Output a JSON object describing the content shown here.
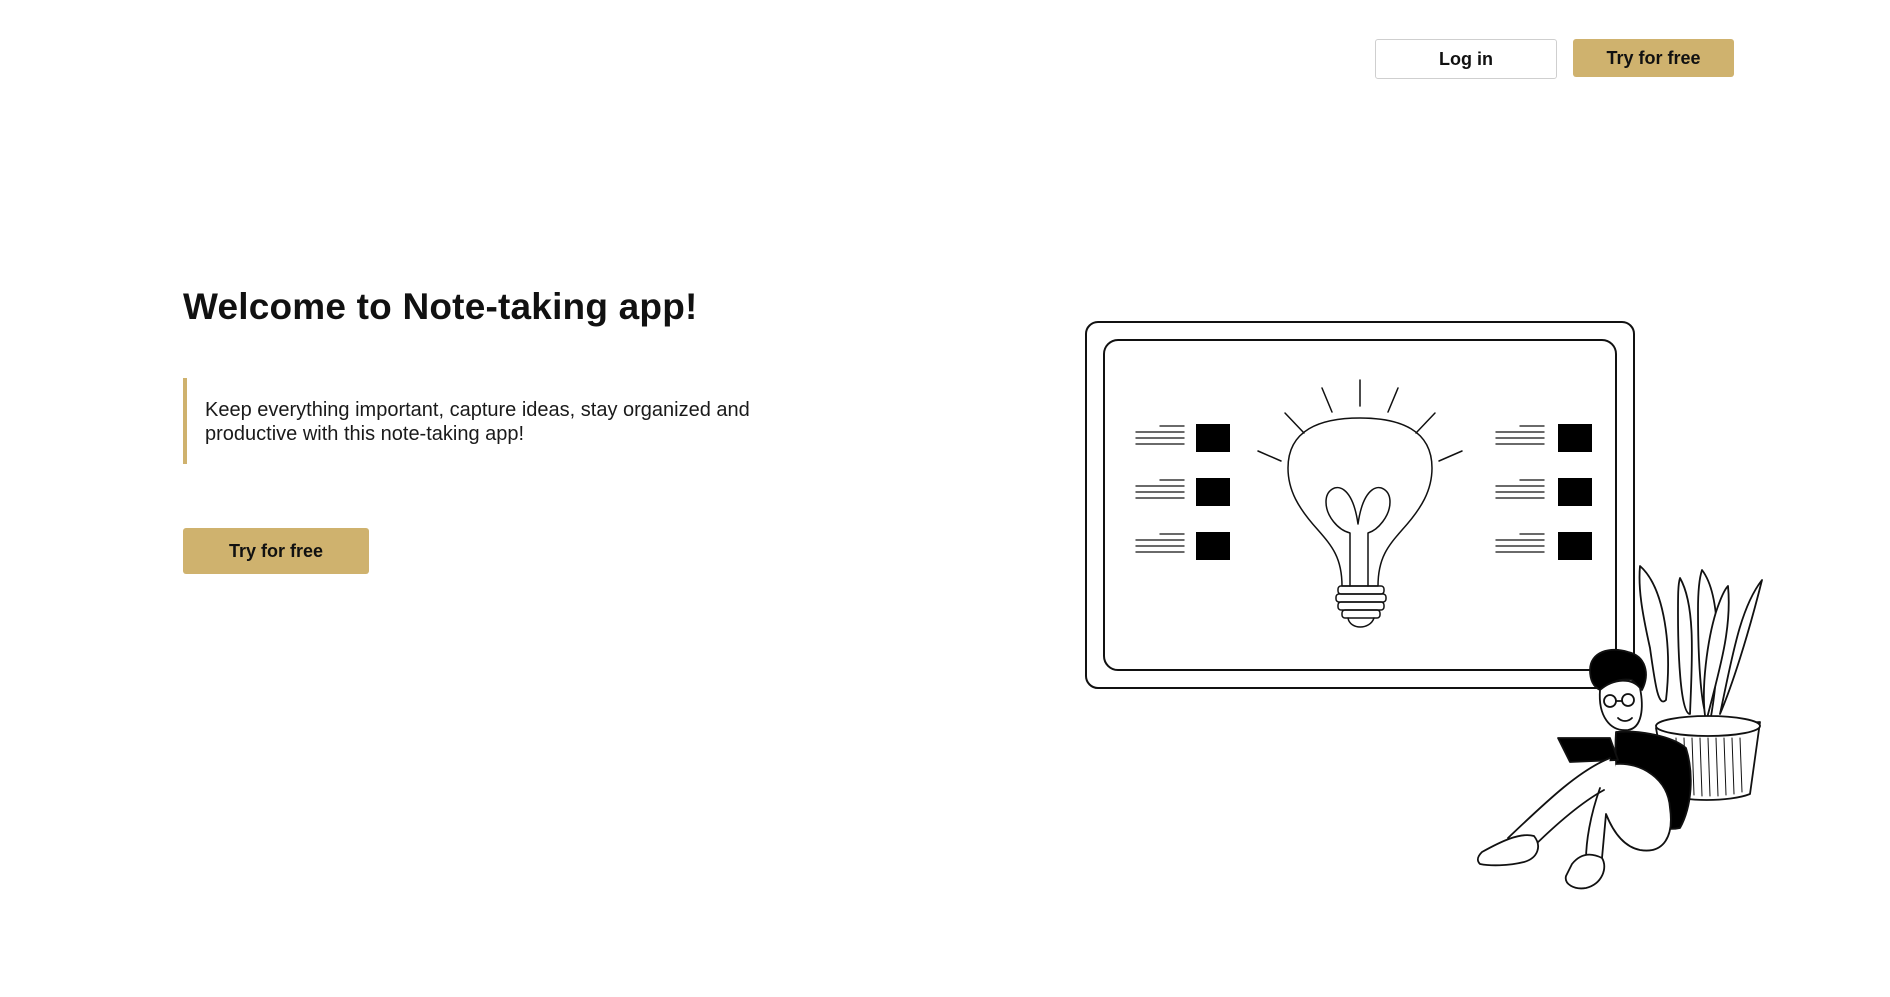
{
  "header": {
    "login_label": "Log in",
    "try_label": "Try for free"
  },
  "hero": {
    "title": "Welcome to Note-taking app!",
    "description": "Keep everything important, capture ideas, stay organized and productive with this note-taking app!",
    "cta_label": "Try for free"
  },
  "illustration": {
    "icon": "person-with-laptop-and-lightbulb-board-illustration"
  },
  "colors": {
    "accent": "#cfb26e",
    "text": "#111111",
    "background": "#ffffff"
  }
}
